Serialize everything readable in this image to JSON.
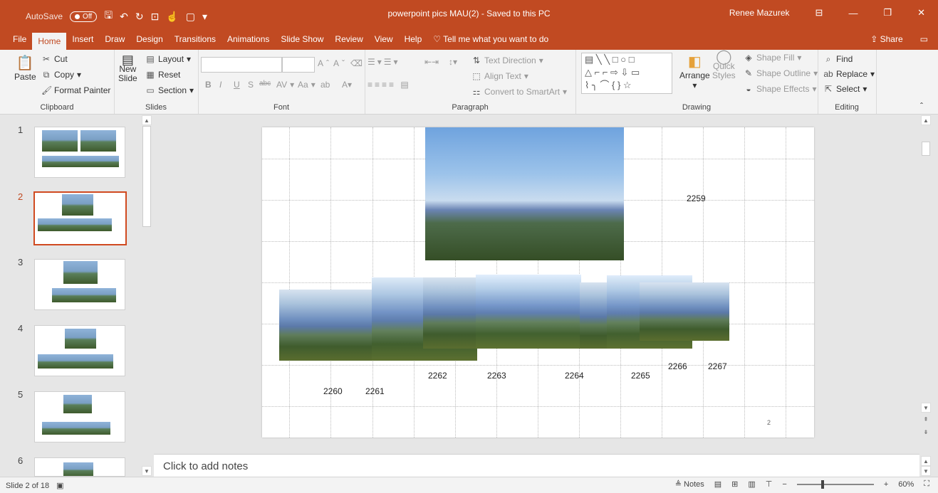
{
  "window": {
    "autosave_label": "AutoSave",
    "autosave_state": "Off",
    "title": "powerpoint pics MAU(2) - Saved to this PC",
    "user": "Renee Mazurek",
    "accent_color": "#c14a22"
  },
  "tabs": [
    "File",
    "Home",
    "Insert",
    "Draw",
    "Design",
    "Transitions",
    "Animations",
    "Slide Show",
    "Review",
    "View",
    "Help"
  ],
  "active_tab": "Home",
  "tell_me": "Tell me what you want to do",
  "share_label": "Share",
  "ribbon": {
    "clipboard": {
      "paste": "Paste",
      "cut": "Cut",
      "copy": "Copy",
      "format_painter": "Format Painter",
      "label": "Clipboard"
    },
    "slides": {
      "new_slide_line1": "New",
      "new_slide_line2": "Slide",
      "layout": "Layout",
      "reset": "Reset",
      "section": "Section",
      "label": "Slides"
    },
    "font": {
      "label": "Font",
      "bold": "B",
      "italic": "I",
      "underline": "U",
      "shadow": "S",
      "strike": "abc",
      "spacing": "AV",
      "case": "Aa",
      "grow": "A",
      "shrink": "A"
    },
    "paragraph": {
      "text_direction": "Text Direction",
      "align_text": "Align Text",
      "convert_smartart": "Convert to SmartArt",
      "label": "Paragraph"
    },
    "drawing": {
      "arrange": "Arrange",
      "quick_styles_1": "Quick",
      "quick_styles_2": "Styles",
      "shape_fill": "Shape Fill",
      "shape_outline": "Shape Outline",
      "shape_effects": "Shape Effects",
      "label": "Drawing"
    },
    "editing": {
      "find": "Find",
      "replace": "Replace",
      "select": "Select",
      "label": "Editing"
    }
  },
  "thumbnails": [
    {
      "num": "1",
      "active": false
    },
    {
      "num": "2",
      "active": true
    },
    {
      "num": "3",
      "active": false
    },
    {
      "num": "4",
      "active": false
    },
    {
      "num": "5",
      "active": false
    },
    {
      "num": "6",
      "active": false
    }
  ],
  "slide": {
    "labels": [
      "2259",
      "2260",
      "2261",
      "2262",
      "2263",
      "2264",
      "2265",
      "2266",
      "2267"
    ],
    "page_number": "2"
  },
  "notes_placeholder": "Click to add notes",
  "status": {
    "slide_info": "Slide 2 of 18",
    "notes": "Notes",
    "zoom": "60%"
  }
}
